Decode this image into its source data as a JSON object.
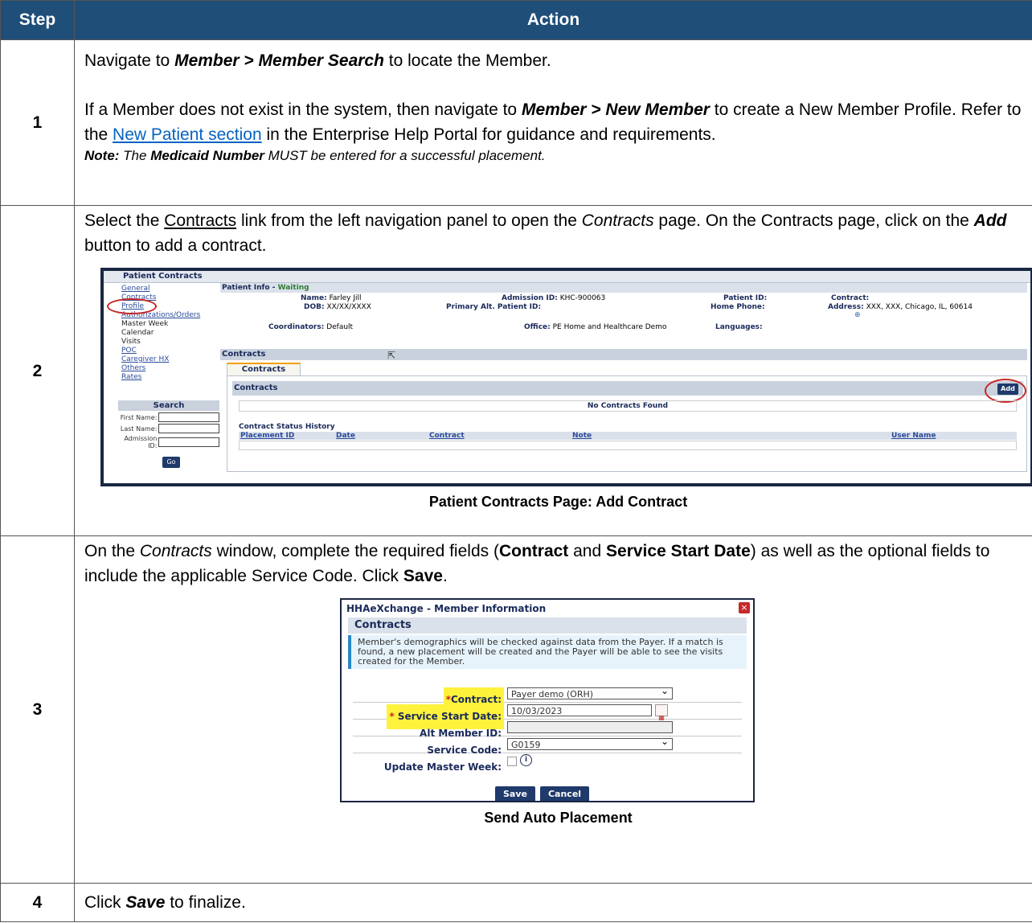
{
  "header": {
    "step": "Step",
    "action": "Action"
  },
  "rows": [
    {
      "num": "1",
      "p1_pre": "Navigate to ",
      "p1_bold": "Member > Member Search",
      "p1_post": " to locate the Member.",
      "p2_pre": "If a Member does not exist in the system, then navigate to ",
      "p2_bold": "Member > New Member",
      "p2_mid": " to create a New Member Profile. Refer to the ",
      "p2_link": "New Patient section",
      "p2_post": " in the Enterprise Help Portal for guidance and requirements.",
      "note_a": "Note:",
      "note_b": " The ",
      "note_c": "Medicaid Number",
      "note_d": " MUST be entered for a successful placement."
    },
    {
      "num": "2",
      "p_pre": "Select the ",
      "p_link": "Contracts",
      "p_mid": " link from the left navigation panel to open the ",
      "p_it": "Contracts",
      "p_mid2": " page. On the Contracts page, click on the ",
      "p_bold": "Add",
      "p_post": " button to add a contract.",
      "caption": "Patient Contracts Page: Add Contract"
    },
    {
      "num": "3",
      "p_pre": "On the ",
      "p_it": "Contracts",
      "p_mid": " window, complete the required fields (",
      "p_b1": "Contract",
      "p_and": " and ",
      "p_b2": "Service Start Date",
      "p_mid2": ") as well as the optional fields to include the applicable Service Code. Click ",
      "p_b3": "Save",
      "p_post": ".",
      "caption": "Send Auto Placement"
    },
    {
      "num": "4",
      "p_pre": "Click ",
      "p_bold": "Save",
      "p_post": " to finalize."
    }
  ],
  "shot1": {
    "title": "Patient Contracts",
    "nav": [
      "General",
      "Contracts",
      "Profile",
      "Authorizations/Orders",
      "Master Week",
      "Calendar",
      "Visits",
      "POC",
      "Caregiver HX",
      "Others",
      "Rates"
    ],
    "search_title": "Search",
    "first_label": "First Name:",
    "last_label": "Last Name:",
    "adm_label": "Admission ID:",
    "go": "Go",
    "patient_info": "Patient Info - ",
    "status": "Waiting",
    "name_l": "Name:",
    "name_v": "Farley Jill",
    "dob_l": "DOB:",
    "dob_v": "XX/XX/XXXX",
    "coord_l": "Coordinators:",
    "coord_v": "Default",
    "admid_l": "Admission ID:",
    "admid_v": "KHC-900063",
    "alt_l": "Primary Alt. Patient ID:",
    "office_l": "Office:",
    "office_v": "PE Home and Healthcare Demo",
    "pid_l": "Patient ID:",
    "phone_l": "Home Phone:",
    "lang_l": "Languages:",
    "contract_l": "Contract:",
    "addr_l": "Address:",
    "addr_v": "XXX, XXX, Chicago, IL, 60614",
    "contracts_hd": "Contracts",
    "tab": "Contracts",
    "inner": "Contracts",
    "add": "Add",
    "none": "No Contracts Found",
    "history": "Contract Status History",
    "cols": [
      "Placement ID",
      "Date",
      "Contract",
      "Note",
      "User Name"
    ]
  },
  "shot2": {
    "title": "HHAeXchange - Member Information",
    "close": "×",
    "header": "Contracts",
    "info": "Member's demographics will be checked against data from the Payer. If a match is found, a new placement will be created and the Payer will be able to see the visits created for the Member.",
    "contract_l": "Contract:",
    "contract_v": "Payer demo (ORH)",
    "start_l": "Service Start Date:",
    "start_v": "10/03/2023",
    "alt_l": "Alt Member ID:",
    "alt_v": "",
    "code_l": "Service Code:",
    "code_v": "G0159",
    "umw_l": "Update Master Week:",
    "save": "Save",
    "cancel": "Cancel"
  }
}
